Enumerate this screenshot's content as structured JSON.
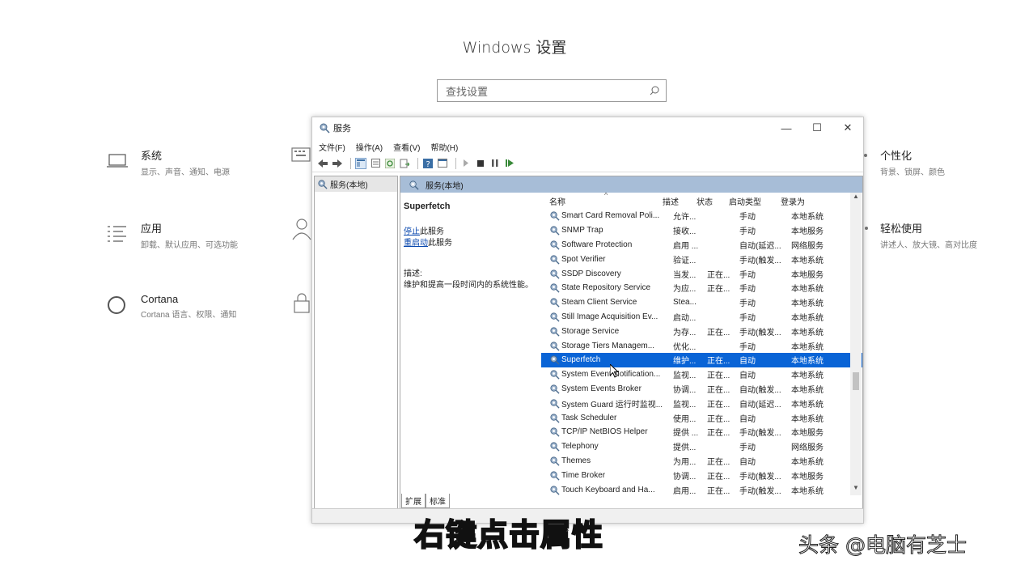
{
  "settings": {
    "title": "Windows 设置",
    "search_placeholder": "查找设置",
    "categories": [
      {
        "title": "系统",
        "sub": "显示、声音、通知、电源",
        "icon": "laptop-icon"
      },
      {
        "title": "应用",
        "sub": "卸载、默认应用、可选功能",
        "icon": "apps-list-icon"
      },
      {
        "title": "Cortana",
        "sub": "Cortana 语言、权限、通知",
        "icon": "cortana-circle-icon"
      },
      {
        "title": "个性化",
        "sub": "背景、锁屏、颜色",
        "icon": "personalization-icon"
      },
      {
        "title": "轻松使用",
        "sub": "讲述人、放大镜、高对比度",
        "icon": "ease-of-access-icon"
      }
    ]
  },
  "services_window": {
    "title": "服务",
    "menu": [
      "文件(F)",
      "操作(A)",
      "查看(V)",
      "帮助(H)"
    ],
    "controls": {
      "minimize": "—",
      "maximize": "☐",
      "close": "✕"
    },
    "tree_item": "服务(本地)",
    "pane_header": "服务(本地)",
    "selected_service": {
      "name": "Superfetch",
      "stop_link": "停止",
      "stop_suffix": "此服务",
      "restart_link": "重启动",
      "restart_suffix": "此服务",
      "desc_label": "描述:",
      "desc_text": "维护和提高一段时间内的系统性能。"
    },
    "columns": [
      "名称",
      "描述",
      "状态",
      "启动类型",
      "登录为"
    ],
    "rows": [
      {
        "name": "Smart Card Removal Poli...",
        "desc": "允许...",
        "status": "",
        "start": "手动",
        "logon": "本地系统"
      },
      {
        "name": "SNMP Trap",
        "desc": "接收...",
        "status": "",
        "start": "手动",
        "logon": "本地服务"
      },
      {
        "name": "Software Protection",
        "desc": "启用 ...",
        "status": "",
        "start": "自动(延迟...",
        "logon": "网络服务"
      },
      {
        "name": "Spot Verifier",
        "desc": "验证...",
        "status": "",
        "start": "手动(触发...",
        "logon": "本地系统"
      },
      {
        "name": "SSDP Discovery",
        "desc": "当发...",
        "status": "正在...",
        "start": "手动",
        "logon": "本地服务"
      },
      {
        "name": "State Repository Service",
        "desc": "为应...",
        "status": "正在...",
        "start": "手动",
        "logon": "本地系统"
      },
      {
        "name": "Steam Client Service",
        "desc": "Stea...",
        "status": "",
        "start": "手动",
        "logon": "本地系统"
      },
      {
        "name": "Still Image Acquisition Ev...",
        "desc": "启动...",
        "status": "",
        "start": "手动",
        "logon": "本地系统"
      },
      {
        "name": "Storage Service",
        "desc": "为存...",
        "status": "正在...",
        "start": "手动(触发...",
        "logon": "本地系统"
      },
      {
        "name": "Storage Tiers Managem...",
        "desc": "优化...",
        "status": "",
        "start": "手动",
        "logon": "本地系统"
      },
      {
        "name": "Superfetch",
        "desc": "维护...",
        "status": "正在...",
        "start": "自动",
        "logon": "本地系统"
      },
      {
        "name": "System Event Notification...",
        "desc": "监视...",
        "status": "正在...",
        "start": "自动",
        "logon": "本地系统"
      },
      {
        "name": "System Events Broker",
        "desc": "协调...",
        "status": "正在...",
        "start": "自动(触发...",
        "logon": "本地系统"
      },
      {
        "name": "System Guard 运行时监视...",
        "desc": "监视...",
        "status": "正在...",
        "start": "自动(延迟...",
        "logon": "本地系统"
      },
      {
        "name": "Task Scheduler",
        "desc": "使用...",
        "status": "正在...",
        "start": "自动",
        "logon": "本地系统"
      },
      {
        "name": "TCP/IP NetBIOS Helper",
        "desc": "提供 ...",
        "status": "正在...",
        "start": "手动(触发...",
        "logon": "本地服务"
      },
      {
        "name": "Telephony",
        "desc": "提供...",
        "status": "",
        "start": "手动",
        "logon": "网络服务"
      },
      {
        "name": "Themes",
        "desc": "为用...",
        "status": "正在...",
        "start": "自动",
        "logon": "本地系统"
      },
      {
        "name": "Time Broker",
        "desc": "协调...",
        "status": "正在...",
        "start": "手动(触发...",
        "logon": "本地服务"
      },
      {
        "name": "Touch Keyboard and Ha...",
        "desc": "启用...",
        "status": "正在...",
        "start": "手动(触发...",
        "logon": "本地系统"
      }
    ],
    "selected_index": 10,
    "tabs": [
      "扩展",
      "标准"
    ]
  },
  "overlay": {
    "subtitle": "右键点击属性",
    "watermark": "头条 @电脑有芝士"
  },
  "colors": {
    "selection": "#0a64d6",
    "pane_header": "#a7bdd7"
  }
}
